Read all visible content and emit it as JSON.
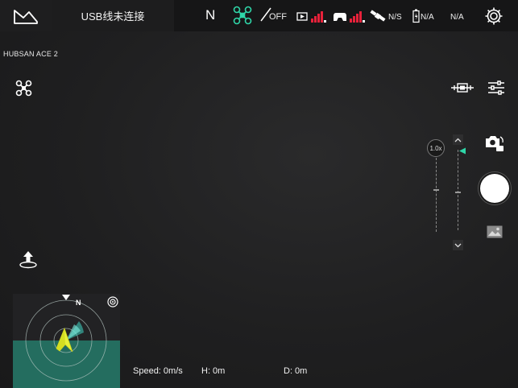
{
  "topbar": {
    "logo_icon": "mountain-logo-icon",
    "usb_status": "USB线未连接",
    "heading": "N",
    "light_status": "OFF",
    "gps_status": "N/S",
    "battery_status": "N/A",
    "extra_status": "N/A",
    "settings_icon": "gear-icon"
  },
  "drone_model": "HUBSAN ACE 2",
  "camera": {
    "zoom_label": "1.0x"
  },
  "map": {
    "north_label": "N"
  },
  "telemetry": {
    "speed": "Speed: 0m/s",
    "height": "H: 0m",
    "distance": "D: 0m"
  },
  "colors": {
    "accent": "#2fd6a8",
    "signal_red": "#e8213a",
    "map_ground": "#246d5f",
    "aircraft_yellow": "#e6f13a"
  }
}
